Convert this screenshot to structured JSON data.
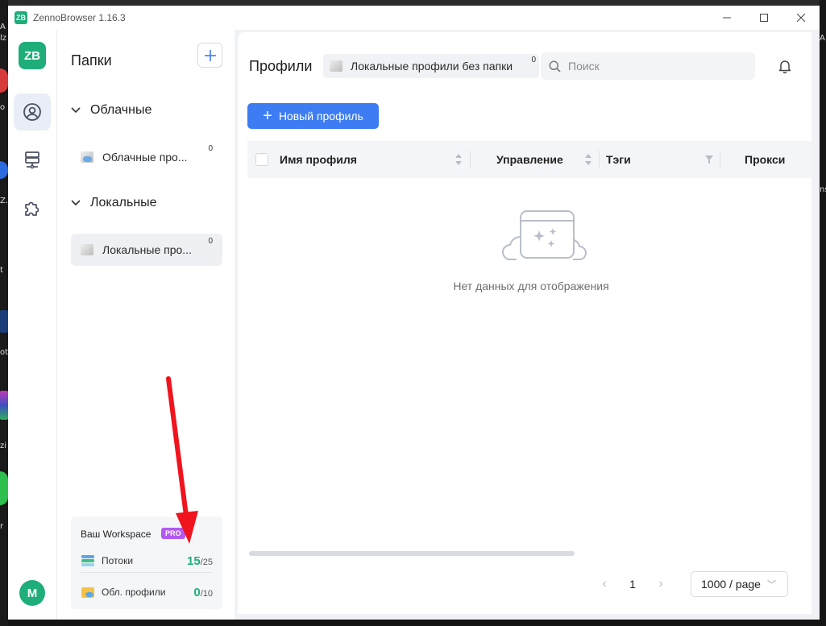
{
  "window": {
    "title": "ZennoBrowser 1.16.3",
    "badge": "ZB"
  },
  "rail": {
    "logo": "ZB",
    "items": [
      {
        "icon": "profile-icon",
        "active": true
      },
      {
        "icon": "network-icon",
        "active": false
      },
      {
        "icon": "puzzle-icon",
        "active": false
      }
    ],
    "avatar": "M"
  },
  "folders": {
    "title": "Папки",
    "groups": [
      {
        "label": "Облачные",
        "items": [
          {
            "label": "Облачные про...",
            "count": "0"
          }
        ]
      },
      {
        "label": "Локальные",
        "items": [
          {
            "label": "Локальные про...",
            "count": "0"
          }
        ]
      }
    ]
  },
  "workspace": {
    "title": "Ваш Workspace",
    "badge": "PRO",
    "rows": [
      {
        "label": "Потоки",
        "used": "15",
        "total": "/25"
      },
      {
        "label": "Обл. профили",
        "used": "0",
        "total": "/10"
      }
    ]
  },
  "main": {
    "title": "Профили",
    "breadcrumb": {
      "label": "Локальные профили без папки",
      "count": "0"
    },
    "search_placeholder": "Поиск",
    "new_profile": "Новый профиль",
    "columns": [
      "Имя профиля",
      "Управление",
      "Тэги",
      "Прокси"
    ],
    "empty_text": "Нет данных для отображения",
    "pager": {
      "page": "1",
      "page_size": "1000 / page"
    }
  },
  "desktop": {
    "left_fragments": [
      "A",
      "lz",
      "o",
      "Z.z",
      "t",
      "ot",
      "zi",
      "r"
    ],
    "right_fragments": [
      "A",
      "ns"
    ]
  },
  "colors": {
    "accent": "#3d7cf2",
    "brand": "#1fae7a",
    "pro": "#b25af0",
    "arrow": "#f0141e"
  }
}
